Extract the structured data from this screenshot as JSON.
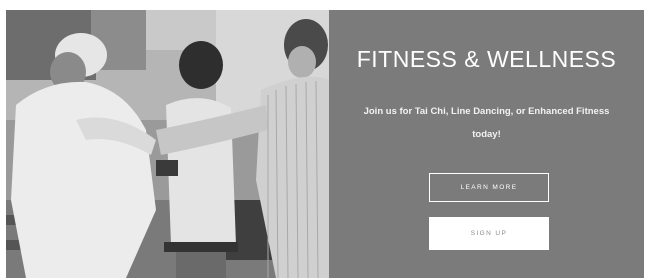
{
  "hero": {
    "title": "FITNESS & WELLNESS",
    "subtitle": "Join us for Tai Chi, Line Dancing, or Enhanced Fitness today!",
    "learn_more_label": "LEARN MORE",
    "sign_up_label": "SIGN UP"
  },
  "colors": {
    "panel_bg": "#7b7b7b",
    "heading_text": "#ffffff",
    "sign_up_button_bg": "#ffffff"
  }
}
